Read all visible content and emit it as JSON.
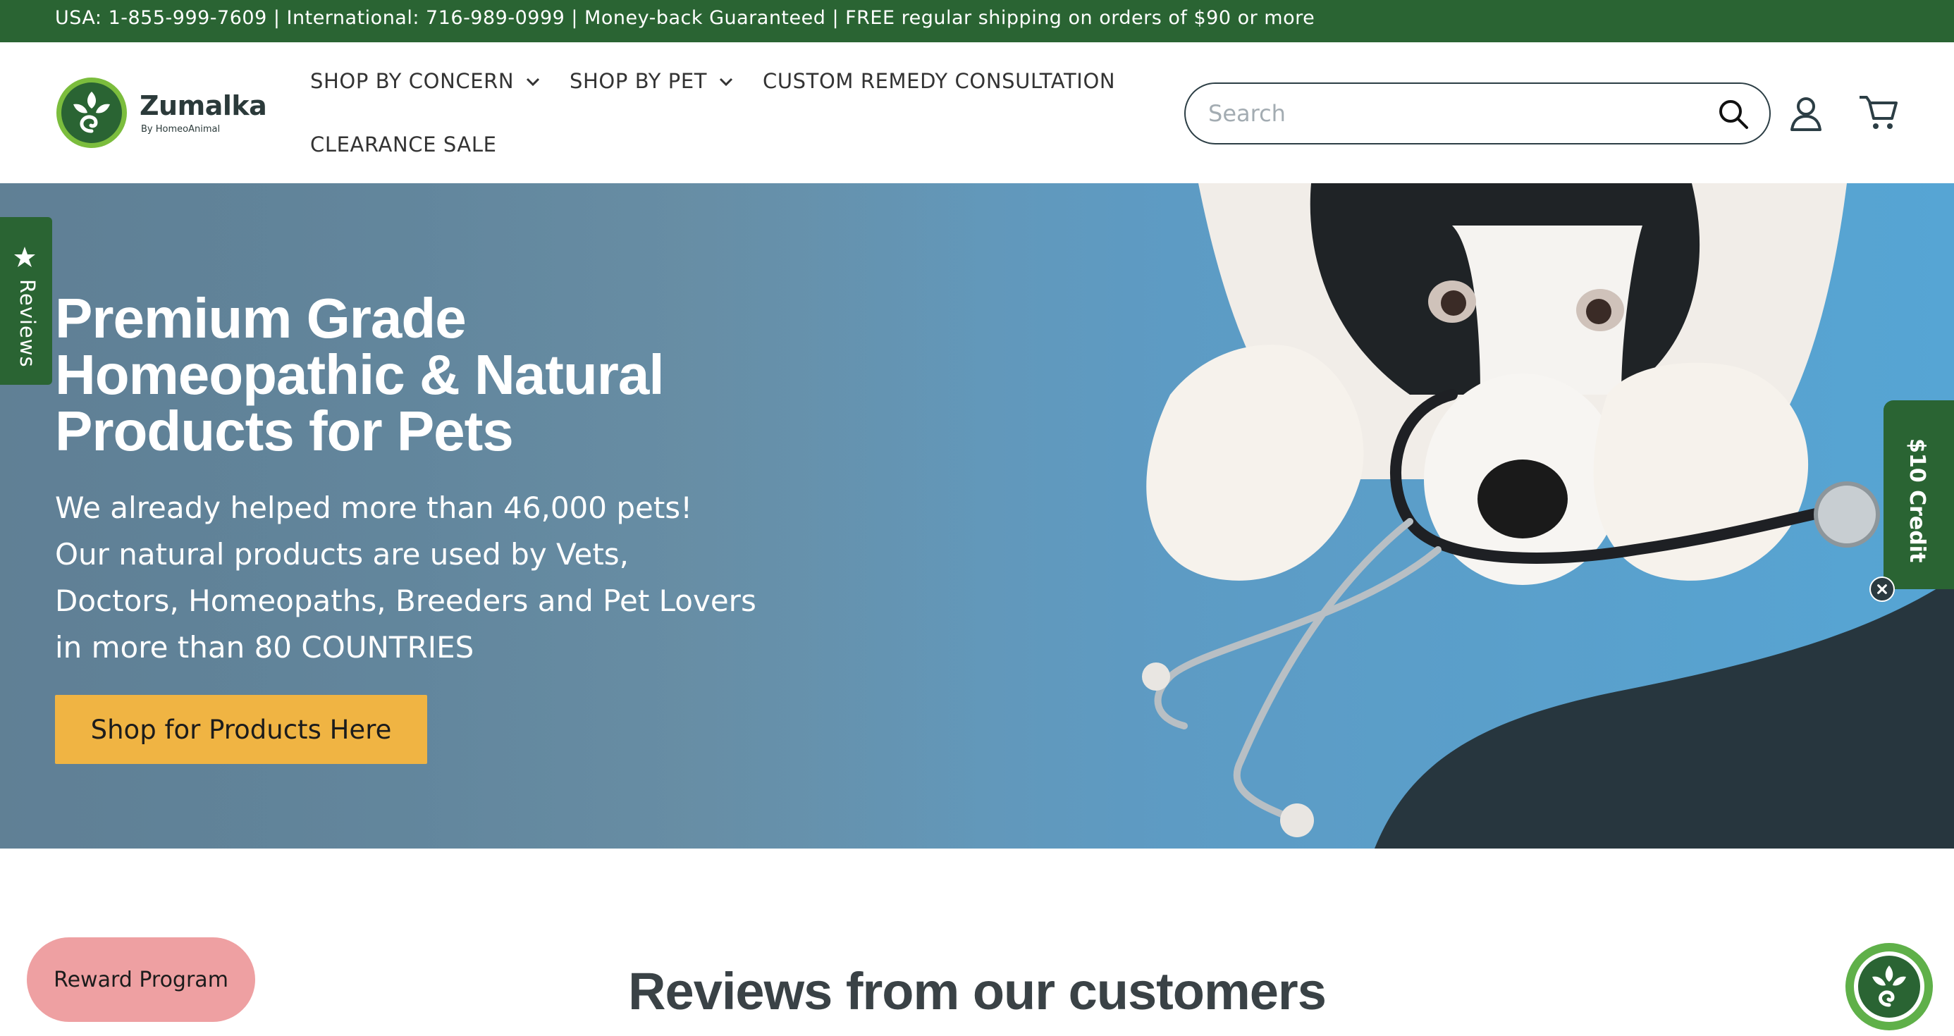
{
  "announcement": "USA: 1-855-999-7609 | International: 716-989-0999 | Money-back Guaranteed | FREE regular shipping on orders of $90 or more",
  "brand": {
    "name": "Zumalka",
    "subtitle": "By HomeoAnimal",
    "color": "#2a6433"
  },
  "nav": {
    "items": [
      {
        "label": "SHOP BY CONCERN",
        "has_dropdown": true
      },
      {
        "label": "SHOP BY PET",
        "has_dropdown": true
      },
      {
        "label": "CUSTOM REMEDY CONSULTATION",
        "has_dropdown": false
      },
      {
        "label": "CLEARANCE SALE",
        "has_dropdown": false
      }
    ]
  },
  "search": {
    "placeholder": "Search",
    "value": ""
  },
  "header_icons": [
    "search-icon",
    "account-icon",
    "cart-icon"
  ],
  "hero": {
    "title": "Premium Grade Homeopathic & Natural Products for Pets",
    "subtitle_lines": [
      "We already helped more than 46,000 pets!",
      "Our natural products are used by Vets,",
      "Doctors, Homeopaths, Breeders and Pet Lovers",
      "in more than 80 COUNTRIES"
    ],
    "cta_label": "Shop for Products Here",
    "cta_color": "#f0b443"
  },
  "side_tabs": {
    "reviews_label": "Reviews",
    "credit_label": "$10 Credit"
  },
  "reviews_section": {
    "heading": "Reviews from our customers"
  },
  "reward_button": {
    "label": "Reward Program",
    "color": "#eea0a2"
  }
}
